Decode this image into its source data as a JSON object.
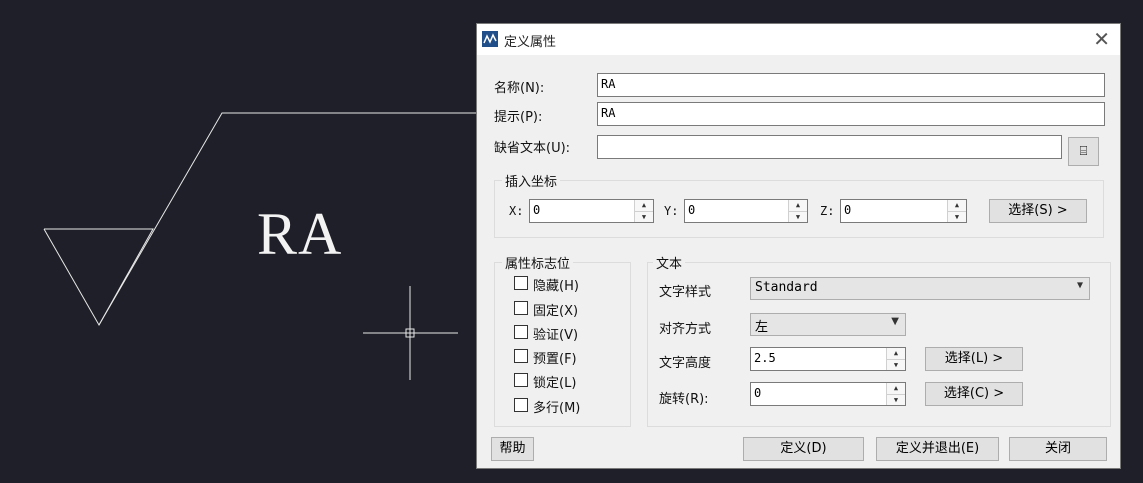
{
  "drawing": {
    "text": "RA"
  },
  "dialog": {
    "title": "定义属性",
    "close_icon": "close-icon",
    "name_label": "名称(N):",
    "name_value": "RA",
    "prompt_label": "提示(P):",
    "prompt_value": "RA",
    "default_label": "缺省文本(U):",
    "default_value": "",
    "field_icon": "insert-field-icon",
    "insert_point": {
      "title": "插入坐标",
      "x_label": "X:",
      "x_value": "0",
      "y_label": "Y:",
      "y_value": "0",
      "z_label": "Z:",
      "z_value": "0",
      "select_button": "选择(S) >"
    },
    "flags": {
      "title": "属性标志位",
      "items": [
        {
          "label": "隐藏(H)",
          "checked": false
        },
        {
          "label": "固定(X)",
          "checked": false
        },
        {
          "label": "验证(V)",
          "checked": false
        },
        {
          "label": "预置(F)",
          "checked": false
        },
        {
          "label": "锁定(L)",
          "checked": false
        },
        {
          "label": "多行(M)",
          "checked": false
        }
      ]
    },
    "text": {
      "title": "文本",
      "style_label": "文字样式",
      "style_value": "Standard",
      "align_label": "对齐方式",
      "align_value": "左",
      "height_label": "文字高度",
      "height_value": "2.5",
      "height_select": "选择(L) >",
      "rotation_label": "旋转(R):",
      "rotation_value": "0",
      "rotation_select": "选择(C) >"
    },
    "buttons": {
      "help": "帮助",
      "define": "定义(D)",
      "define_exit": "定义并退出(E)",
      "close": "关闭"
    }
  }
}
